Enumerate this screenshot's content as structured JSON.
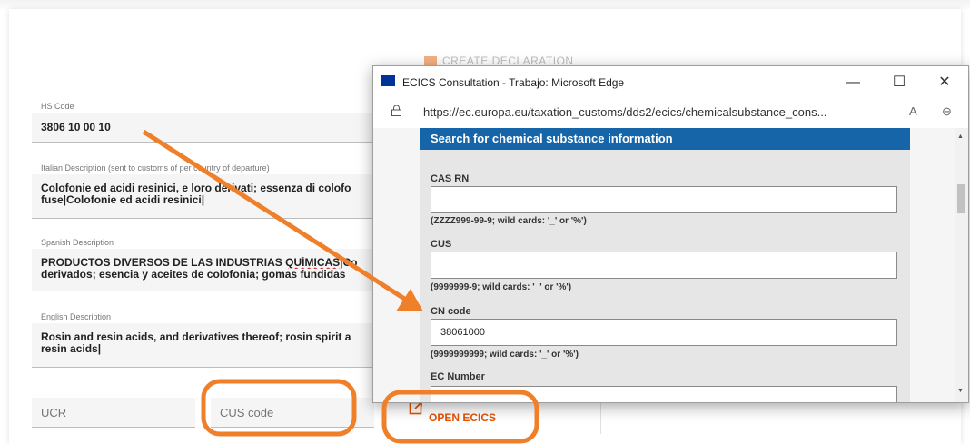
{
  "form": {
    "hs_code": {
      "label": "HS Code",
      "value": "3806 10 00 10"
    },
    "italian": {
      "label": "Italian Description (sent to customs of per country of departure)",
      "line1": "Colofonie ed acidi resinici, e loro derivati; essenza di colofo",
      "line2": "fuse|Colofonie ed acidi resinici|"
    },
    "spanish": {
      "label": "Spanish Description",
      "line1a": "PRODUCTOS DIVERSOS DE LAS INDUSTRIAS ",
      "line1b": "QUÍMICAS",
      "line1c": "|Co",
      "line2": "derivados; esencia y aceites de colofonia; gomas fundidas"
    },
    "english": {
      "label": "English Description",
      "line1": "Rosin and resin acids, and derivatives thereof; rosin spirit a",
      "line2": "resin acids|"
    },
    "ucr_label": "UCR",
    "cus_label": "CUS code",
    "create_declaration": "CREATE DECLARATION",
    "open_ecics": "OPEN ECICS"
  },
  "popup": {
    "title": "ECICS Consultation - Trabajo: Microsoft Edge",
    "minimize": "—",
    "maximize": "☐",
    "close": "✕",
    "url": "https://ec.europa.eu/taxation_customs/dds2/ecics/chemicalsubstance_cons...",
    "read_aloud": "A",
    "zoom": "⊖",
    "panel_title": "Search for chemical substance information",
    "cas_label": "CAS RN",
    "cas_hint": "(ZZZZ999-99-9; wild cards: '_' or '%')",
    "cus_label": "CUS",
    "cus_hint": "(9999999-9; wild cards: '_' or '%')",
    "cn_label": "CN code",
    "cn_value": "38061000",
    "cn_hint": "(9999999999; wild cards: '_' or '%')",
    "ec_label": "EC Number"
  },
  "colors": {
    "accent_orange": "#f07f2a",
    "panel_blue": "#1565a8"
  }
}
